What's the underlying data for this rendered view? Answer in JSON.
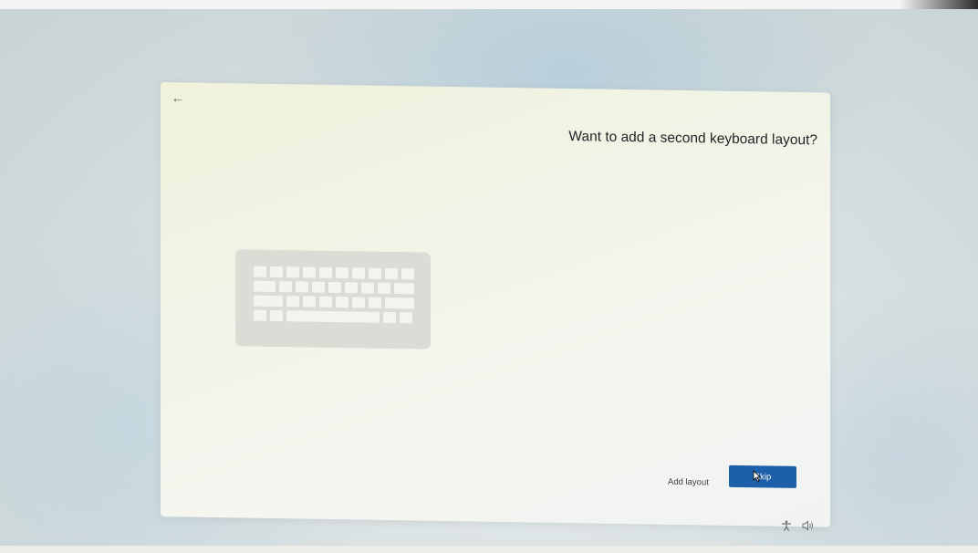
{
  "oobe": {
    "back_icon": "arrow-left-icon",
    "title": "Want to add a second keyboard layout?",
    "illustration_icon": "keyboard-icon",
    "add_layout_label": "Add layout",
    "skip_label": "Skip"
  },
  "system_tray": {
    "accessibility_icon": "ease-of-access-icon",
    "volume_icon": "volume-icon"
  },
  "colors": {
    "accent": "#1d5fa8",
    "card_background": "#f3f4ea",
    "title_text": "#1f2326"
  }
}
